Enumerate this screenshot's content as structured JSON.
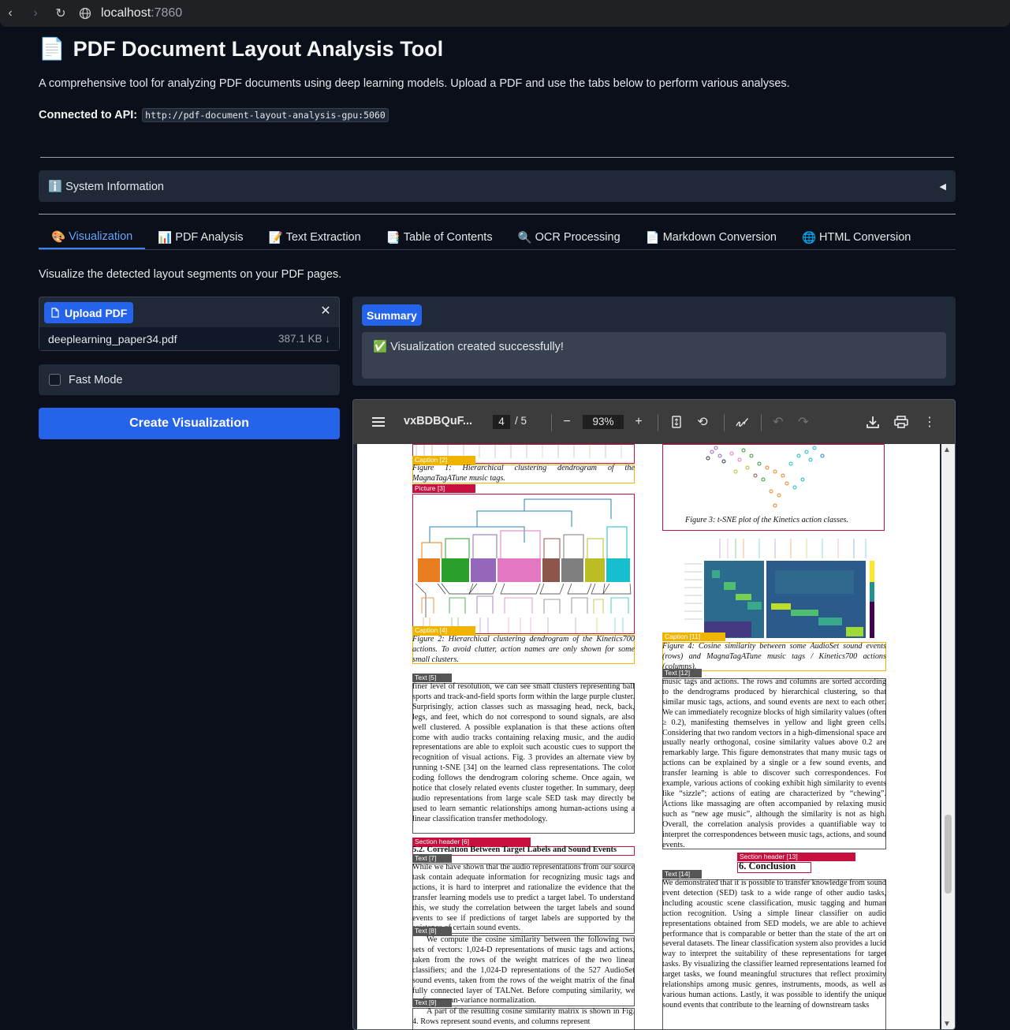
{
  "browser": {
    "host": "localhost",
    "port": ":7860"
  },
  "app": {
    "title": "PDF Document Layout Analysis Tool",
    "description": "A comprehensive tool for analyzing PDF documents using deep learning models. Upload a PDF and use the tabs below to perform various analyses.",
    "api_label": "Connected to API:",
    "api_url": "http://pdf-document-layout-analysis-gpu:5060",
    "system_info": "System Information"
  },
  "tabs": [
    {
      "icon": "🎨",
      "label": "Visualization"
    },
    {
      "icon": "📊",
      "label": "PDF Analysis"
    },
    {
      "icon": "📝",
      "label": "Text Extraction"
    },
    {
      "icon": "📑",
      "label": "Table of Contents"
    },
    {
      "icon": "🔍",
      "label": "OCR Processing"
    },
    {
      "icon": "📄",
      "label": "Markdown Conversion"
    },
    {
      "icon": "🌐",
      "label": "HTML Conversion"
    }
  ],
  "visualization": {
    "description": "Visualize the detected layout segments on your PDF pages.",
    "upload_label": "Upload PDF",
    "file_name": "deeplearning_paper34.pdf",
    "file_size": "387.1 KB ↓",
    "fast_mode_label": "Fast Mode",
    "create_button": "Create Visualization",
    "summary_label": "Summary",
    "summary_text": "✅ Visualization created successfully!"
  },
  "viewer": {
    "file_name": "vxBDBQuF...",
    "page": "4",
    "page_total": "/  5",
    "zoom": "93%"
  },
  "pdf_page": {
    "tags": {
      "cap2": "Caption  [2]",
      "pic3": "Picture  [3]",
      "cap4": "Caption  [4]",
      "txt5": "Text  [5]",
      "sh6": "Section header  [6]",
      "txt7": "Text  [7]",
      "txt8": "Text  [8]",
      "txt9": "Text  [9]",
      "cap11": "Caption  [11]",
      "txt12": "Text  [12]",
      "sh13": "Section header  [13]",
      "txt14": "Text  [14]"
    },
    "fig1_caption": "Figure 1: Hierarchical clustering dendrogram of the MagnaTagATune music tags.",
    "fig2_caption": "Figure 2: Hierarchical clustering dendrogram of the Kinetics700 actions. To avoid clutter, action names are only shown for some small clusters.",
    "fig3_caption": "Figure 3: t-SNE plot of the Kinetics action classes.",
    "fig4_caption": "Figure 4: Cosine similarity between some AudioSet sound events (rows) and MagnaTagATune music tags / Kinetics700 actions (columns).",
    "text5": "finer level of resolution, we can see small clusters representing ball sports and track-and-field sports form within the large purple cluster. Surprisingly, action classes such as massaging head, neck, back, legs, and feet, which do not correspond to sound signals, are also well clustered. A possible explanation is that these actions often come with audio tracks containing relaxing music, and the audio representations are able to exploit such acoustic cues to support the recognition of visual actions. Fig. 3 provides an alternate view by running t-SNE [34] on the learned class representations. The color coding follows the dendrogram coloring scheme. Once again, we notice that closely related events cluster together. In summary, deep audio representations from large scale SED task may directly be used to learn semantic relationships among human-actions using a linear classification transfer methodology.",
    "section6": "5.2. Correlation Between Target Labels and Sound Events",
    "text7": "While we have shown that the audio representations from our source task contain adequate information for recognizing music tags and actions, it is hard to interpret and rationalize the evidence that the transfer learning models use to predict a target label. To understand this, we study the correlation between the target labels and sound events to see if predictions of target labels are supported by the existence of certain sound events.",
    "text8": "We compute the cosine similarity between the following two sets of vectors: 1,024-D representations of music tags and actions, taken from the rows of the weight matrices of the two linear classifiers; and the 1,024-D representations of the 527 AudioSet sound events, taken from the rows of the weight matrix of the final fully connected layer of TALNet. Before computing similarity, we perform mean-variance normalization.",
    "text9": "A part of the resulting cosine similarity matrix is shown in Fig. 4. Rows represent sound events, and columns represent",
    "text12": "music tags and actions. The rows and columns are sorted according to the dendrograms produced by hierarchical clustering, so that similar music tags, actions, and sound events are next to each other. We can immediately recognize blocks of high similarity values (often ≥ 0.2), manifesting themselves in yellow and light green cells. Considering that two random vectors in a high-dimensional space are usually nearly orthogonal, cosine similarity values above 0.2 are remarkably large. This figure demonstrates that many music tags or actions can be explained by a single or a few sound events, and transfer learning is able to discover such correspondences. For example, various actions of cooking exhibit high similarity to events like “sizzle”; actions of eating are characterized by “chewing”. Actions like massaging are often accompanied by relaxing music such as “new age music”, although the similarity is not as high. Overall, the correlation analysis provides a quantifiable way to interpret the correspondences between music tags, actions, and sound events.",
    "section13": "6. Conclusion",
    "text14": "We demonstrated that it is possible to transfer knowledge from sound event detection (SED) task to a wide range of other audio tasks, including acoustic scene classification, music tagging and human action recognition. Using a simple linear classifier on audio representations obtained from SED models, we are able to achieve performance that is comparable or better than the state of the art on several datasets. The linear classification system also provides a lucid way to interpret the suitability of these representations for target tasks. By visualizing the classifier learned representations learned for target tasks, we found meaningful structures that reflect proximity relationships among music genres, instruments, moods, as well as various human actions. Lastly, it was possible to identify the unique sound events that contribute to the learning of downstream tasks"
  }
}
